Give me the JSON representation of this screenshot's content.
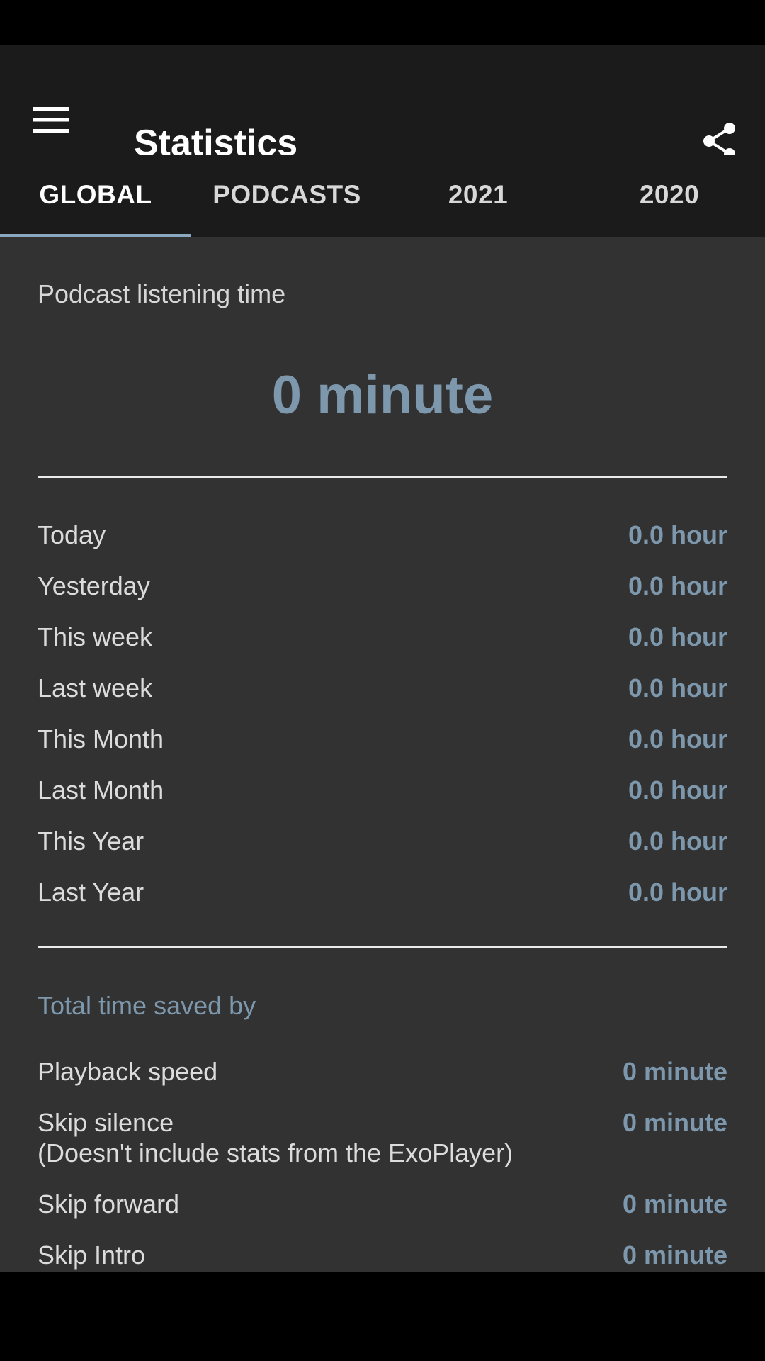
{
  "header": {
    "title": "Statistics"
  },
  "icons": {
    "menu": "hamburger-menu-icon",
    "share": "share-icon"
  },
  "tabs": [
    {
      "label": "GLOBAL",
      "active": true
    },
    {
      "label": "PODCASTS",
      "active": false
    },
    {
      "label": "2021",
      "active": false
    },
    {
      "label": "2020",
      "active": false
    }
  ],
  "listening": {
    "label": "Podcast listening time",
    "total": "0 minute"
  },
  "periods": [
    {
      "label": "Today",
      "value": "0.0 hour"
    },
    {
      "label": "Yesterday",
      "value": "0.0 hour"
    },
    {
      "label": "This week",
      "value": "0.0 hour"
    },
    {
      "label": "Last week",
      "value": "0.0 hour"
    },
    {
      "label": "This Month",
      "value": "0.0 hour"
    },
    {
      "label": "Last Month",
      "value": "0.0 hour"
    },
    {
      "label": "This Year",
      "value": "0.0 hour"
    },
    {
      "label": "Last Year",
      "value": "0.0 hour"
    }
  ],
  "saved": {
    "title": "Total time saved by",
    "items": [
      {
        "label": "Playback speed",
        "value": "0 minute"
      },
      {
        "label": "Skip silence",
        "note": "(Doesn't include stats from the ExoPlayer)",
        "value": "0 minute"
      },
      {
        "label": "Skip forward",
        "value": "0 minute"
      },
      {
        "label": "Skip Intro",
        "value": "0 minute"
      }
    ]
  },
  "colors": {
    "accent": "#7d98ad",
    "indicator": "#8aa8c0",
    "toolbar": "#1b1b1b",
    "content": "#323232"
  }
}
